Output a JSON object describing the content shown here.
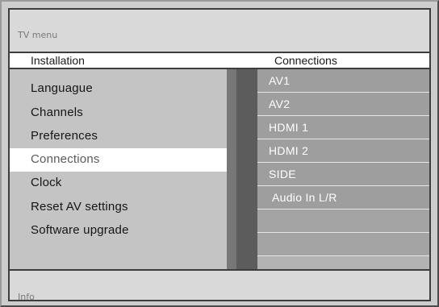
{
  "menu": {
    "title": "TV menu"
  },
  "left_column": {
    "header": "Installation",
    "items": [
      {
        "label": "Languague",
        "selected": false
      },
      {
        "label": "Channels",
        "selected": false
      },
      {
        "label": "Preferences",
        "selected": false
      },
      {
        "label": "Connections",
        "selected": true
      },
      {
        "label": "Clock",
        "selected": false
      },
      {
        "label": "Reset AV settings",
        "selected": false
      },
      {
        "label": "Software upgrade",
        "selected": false
      }
    ]
  },
  "right_column": {
    "header": "Connections",
    "items": [
      {
        "label": "AV1"
      },
      {
        "label": "AV2"
      },
      {
        "label": "HDMI 1"
      },
      {
        "label": "HDMI 2"
      },
      {
        "label": "SIDE"
      },
      {
        "label": "Audio In L/R"
      },
      {
        "label": ""
      },
      {
        "label": ""
      }
    ]
  },
  "footer": {
    "info": "Info"
  }
}
